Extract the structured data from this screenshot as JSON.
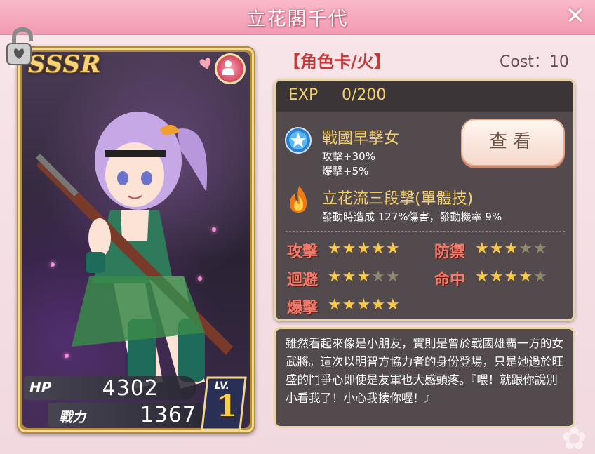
{
  "window": {
    "title": "立花閣千代"
  },
  "card": {
    "rarity": "SSSR",
    "hp_label": "HP",
    "hp_value": "4302",
    "power_label": "戰力",
    "power_value": "1367",
    "level_label": "LV.",
    "level_value": "1"
  },
  "info": {
    "card_type": "【角色卡/火】",
    "cost": "Cost：10",
    "exp_label": "EXP",
    "exp_value": "0/200",
    "skill1": {
      "name": "戰國早擊女",
      "effect1": "攻擊+30%",
      "effect2": "爆擊+5%",
      "icon": "star-badge-icon"
    },
    "view_button": "查看",
    "skill2": {
      "name": "立花流三段擊(單體技)",
      "desc": "發動時造成 127%傷害，發動機率 9%",
      "icon": "fire-icon"
    },
    "stats": [
      {
        "label": "攻擊",
        "stars": 5
      },
      {
        "label": "防禦",
        "stars": 3
      },
      {
        "label": "迴避",
        "stars": 3
      },
      {
        "label": "命中",
        "stars": 4
      },
      {
        "label": "爆擊",
        "stars": 5
      }
    ],
    "max_stars": 5
  },
  "description": "雖然看起來像是小朋友，實則是曾於戰國雄霸一方的女武將。這次以明智方協力者的身份登場，只是她過於旺盛的鬥爭心即使是友軍也大感頭疼。『喂！就跟你說別小看我了！小心我揍你喔！』",
  "colors": {
    "accent_pink": "#f29bb1",
    "gold": "#f3cf6a",
    "stat_red": "#f37a6a"
  }
}
